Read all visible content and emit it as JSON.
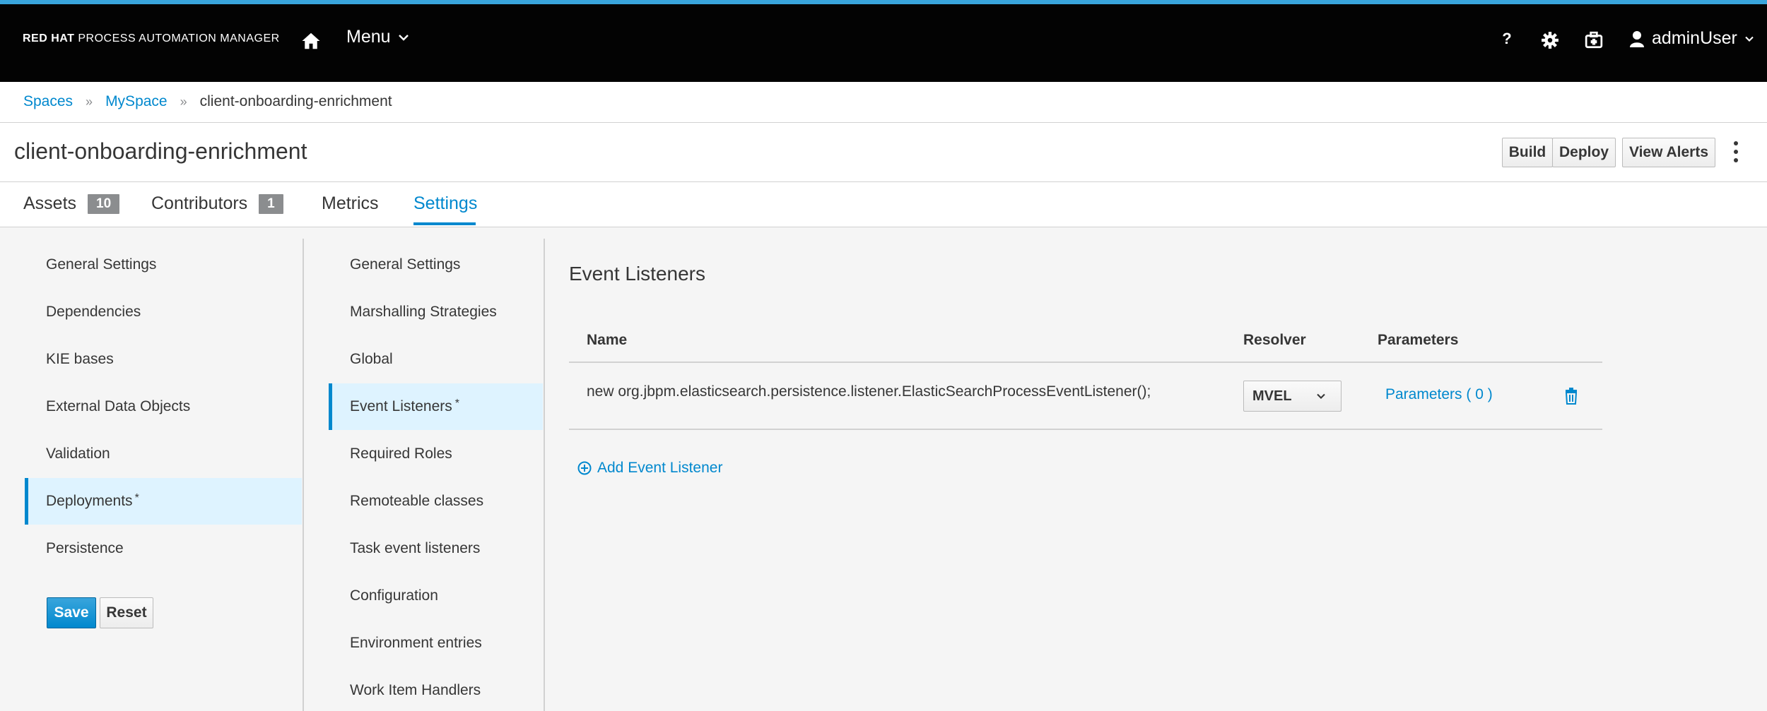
{
  "header": {
    "brand_bold": "RED HAT",
    "brand_rest": " PROCESS AUTOMATION MANAGER",
    "menu_label": "Menu",
    "help_label": "?",
    "user_name": "adminUser"
  },
  "breadcrumb": {
    "items": [
      "Spaces",
      "MySpace"
    ],
    "current": "client-onboarding-enrichment"
  },
  "title": {
    "text": "client-onboarding-enrichment",
    "build_label": "Build",
    "deploy_label": "Deploy",
    "alerts_label": "View Alerts"
  },
  "tabs": [
    {
      "label": "Assets",
      "badge": "10"
    },
    {
      "label": "Contributors",
      "badge": "1"
    },
    {
      "label": "Metrics"
    },
    {
      "label": "Settings"
    }
  ],
  "settings_nav": {
    "items": [
      "General Settings",
      "Dependencies",
      "KIE bases",
      "External Data Objects",
      "Validation",
      "Deployments",
      "Persistence"
    ],
    "selected_marker": "*",
    "save_label": "Save",
    "reset_label": "Reset"
  },
  "deployments_nav": {
    "items": [
      "General Settings",
      "Marshalling Strategies",
      "Global",
      "Event Listeners",
      "Required Roles",
      "Remoteable classes",
      "Task event listeners",
      "Configuration",
      "Environment entries",
      "Work Item Handlers"
    ],
    "selected_marker": "*"
  },
  "event_listeners": {
    "title": "Event Listeners",
    "columns": [
      "Name",
      "Resolver",
      "Parameters"
    ],
    "rows": [
      {
        "name": "new org.jbpm.elasticsearch.persistence.listener.ElasticSearchProcessEventListener();",
        "resolver": "MVEL",
        "parameters": "Parameters ( 0 )"
      }
    ],
    "add_label": "Add Event Listener"
  },
  "colors": {
    "accent": "#0088ce",
    "selected_bg": "#def3ff",
    "navbar_bg": "#030303",
    "top_stripe": "#39a5dc"
  }
}
